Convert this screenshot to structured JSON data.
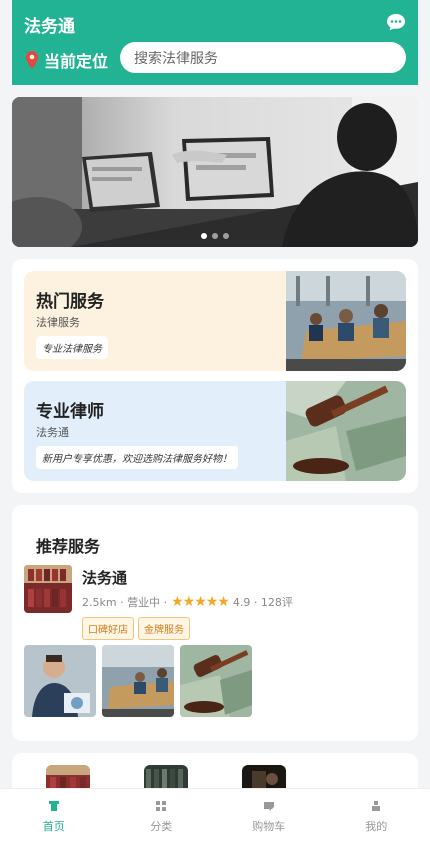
{
  "header": {
    "title": "法务通",
    "location_label": "当前定位",
    "search_placeholder": "搜索法律服务",
    "brand_color": "#21b394"
  },
  "banner": {
    "dots": 3,
    "active_dot": 0
  },
  "promos": [
    {
      "title": "热门服务",
      "subtitle": "法律服务",
      "tag": "专业法律服务",
      "bg": "#fdf1df"
    },
    {
      "title": "专业律师",
      "subtitle": "法务通",
      "tag": "新用户专享优惠，欢迎选购法律服务好物！",
      "bg": "#e2effb"
    }
  ],
  "recommend": {
    "section_title": "推荐服务",
    "shop_name": "法务通",
    "distance": "2.5km",
    "status": "营业中",
    "stars": "★★★★★",
    "rating": "4.9",
    "reviews": "128评",
    "tags": [
      "口碑好店",
      "金牌服务"
    ]
  },
  "tabbar": {
    "items": [
      {
        "label": "首页",
        "icon": "home-icon",
        "active": true
      },
      {
        "label": "分类",
        "icon": "grid-icon",
        "active": false
      },
      {
        "label": "购物车",
        "icon": "cart-icon",
        "active": false
      },
      {
        "label": "我的",
        "icon": "user-icon",
        "active": false
      }
    ]
  }
}
